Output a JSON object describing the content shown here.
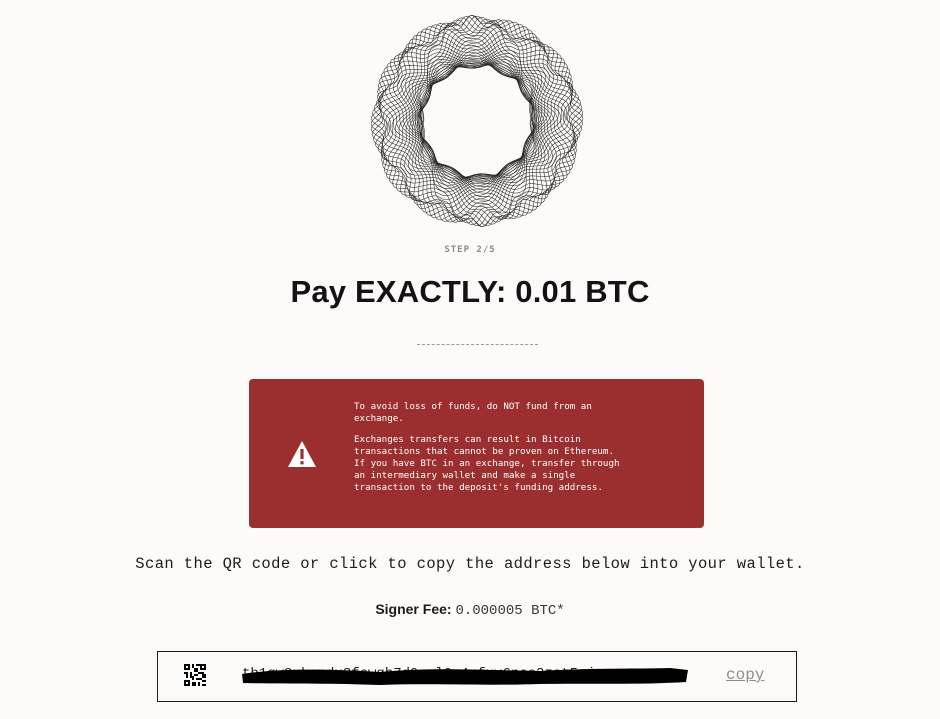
{
  "step": {
    "label": "STEP 2/5"
  },
  "heading": {
    "title": "Pay EXACTLY: 0.01 BTC"
  },
  "warning": {
    "line1": "To avoid loss of funds, do NOT fund from an exchange.",
    "line2": "Exchanges transfers can result in Bitcoin transactions that cannot be proven on Ethereum. If you have BTC in an exchange, transfer through an intermediary wallet and make a single transaction to the deposit's funding address.",
    "icon": "warning-triangle-icon",
    "background_color": "#9b2f2f"
  },
  "instructions": {
    "scan_text": "Scan the QR code or click to copy the address below into your wallet."
  },
  "fee": {
    "label": "Signer Fee:",
    "value": "0.000005 BTC*"
  },
  "address": {
    "value": "tb1qw8xkqpdx3fcwgh7d9sml0y4rfuv6nce2zat5pj",
    "copy_label": "copy",
    "qr_icon": "qr-code-icon"
  }
}
